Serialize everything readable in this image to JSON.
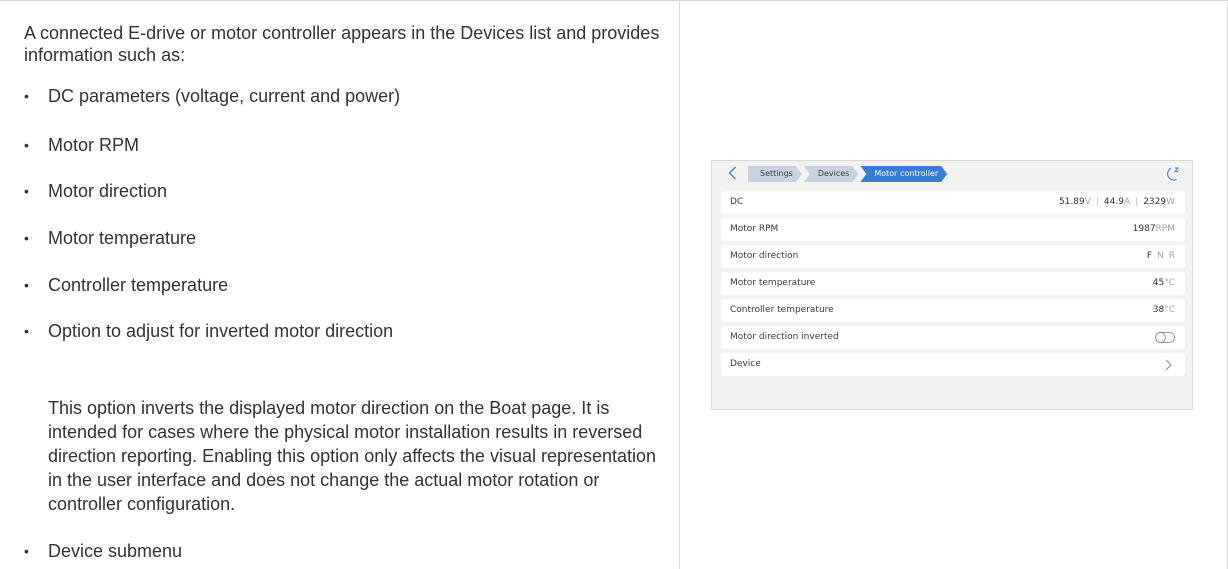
{
  "doc": {
    "intro": "A connected E-drive or motor controller appears in the Devices list and provides information such as:",
    "bullets": [
      "DC parameters (voltage, current and power)",
      "Motor RPM",
      "Motor direction",
      "Motor temperature",
      "Controller temperature",
      "Option to adjust for inverted motor direction",
      "Device submenu"
    ],
    "bullet_mark": "•",
    "inverted_note": "This option inverts the displayed motor direction on the Boat page. It is intended for cases where the physical motor installation results in reversed direction reporting. Enabling this option only affects the visual representation in the user interface and does not change the actual motor rotation or controller configuration."
  },
  "screen": {
    "breadcrumbs": [
      "Settings",
      "Devices",
      "Motor controller"
    ],
    "icons": {
      "back": "chevron-left-icon",
      "status": "sleep-moon-icon",
      "toggle": "toggle-off-icon",
      "submenu": "chevron-right-icon"
    },
    "colors": {
      "accent": "#3a7bd5",
      "crumb": "#c7d3e0",
      "background": "#f2f2f0",
      "row": "#ffffff"
    },
    "rows": {
      "dc": {
        "label": "DC",
        "voltage": "51.89",
        "voltage_unit": "V",
        "current": "44.9",
        "current_unit": "A",
        "power": "2329",
        "power_unit": "W",
        "separator": "|"
      },
      "rpm": {
        "label": "Motor RPM",
        "value": "1987",
        "unit": "RPM"
      },
      "direction": {
        "label": "Motor direction",
        "forward": "F",
        "neutral": "N",
        "reverse": "R",
        "selected": "F"
      },
      "motor_temp": {
        "label": "Motor temperature",
        "value": "45",
        "unit": "°C"
      },
      "controller_temp": {
        "label": "Controller temperature",
        "value": "38",
        "unit": "°C"
      },
      "inverted": {
        "label": "Motor direction inverted",
        "enabled": false
      },
      "device": {
        "label": "Device"
      }
    }
  }
}
